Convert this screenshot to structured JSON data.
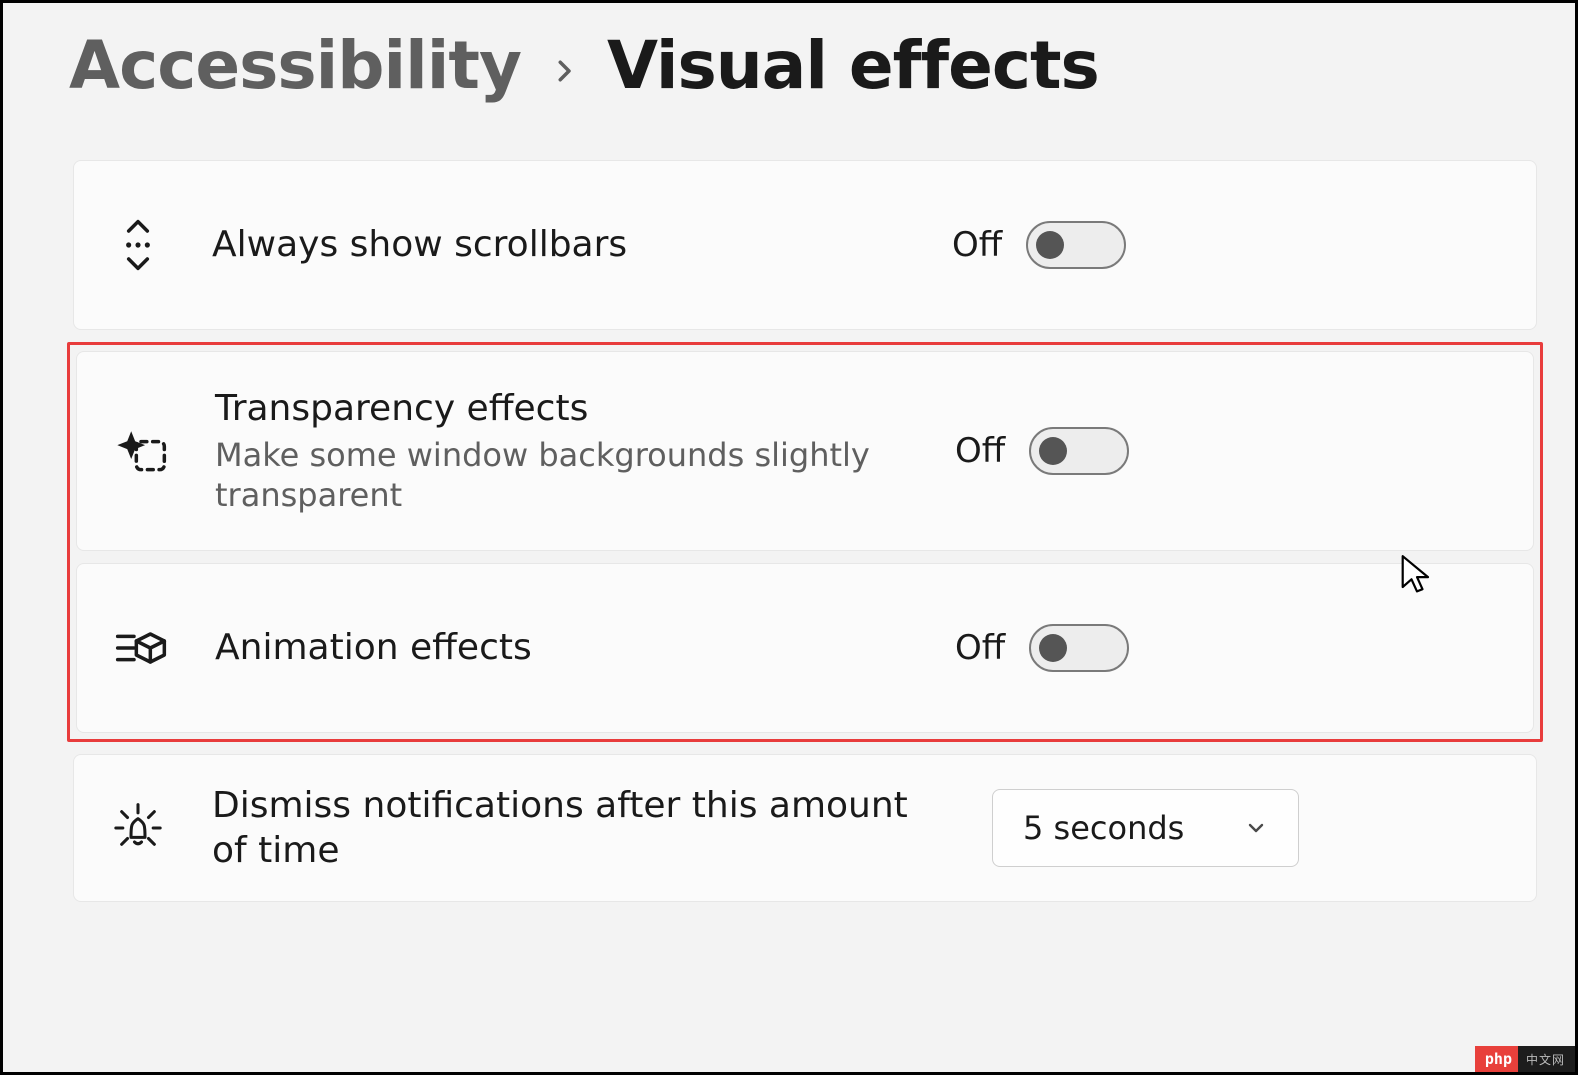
{
  "breadcrumb": {
    "parent": "Accessibility",
    "current": "Visual effects"
  },
  "rows": {
    "scrollbars": {
      "title": "Always show scrollbars",
      "state": "Off"
    },
    "transparency": {
      "title": "Transparency effects",
      "subtitle": "Make some window backgrounds slightly transparent",
      "state": "Off"
    },
    "animation": {
      "title": "Animation effects",
      "state": "Off"
    },
    "dismiss": {
      "title": "Dismiss notifications after this amount of time",
      "value": "5 seconds"
    }
  },
  "watermark": {
    "left": "php",
    "right": "中文网"
  }
}
